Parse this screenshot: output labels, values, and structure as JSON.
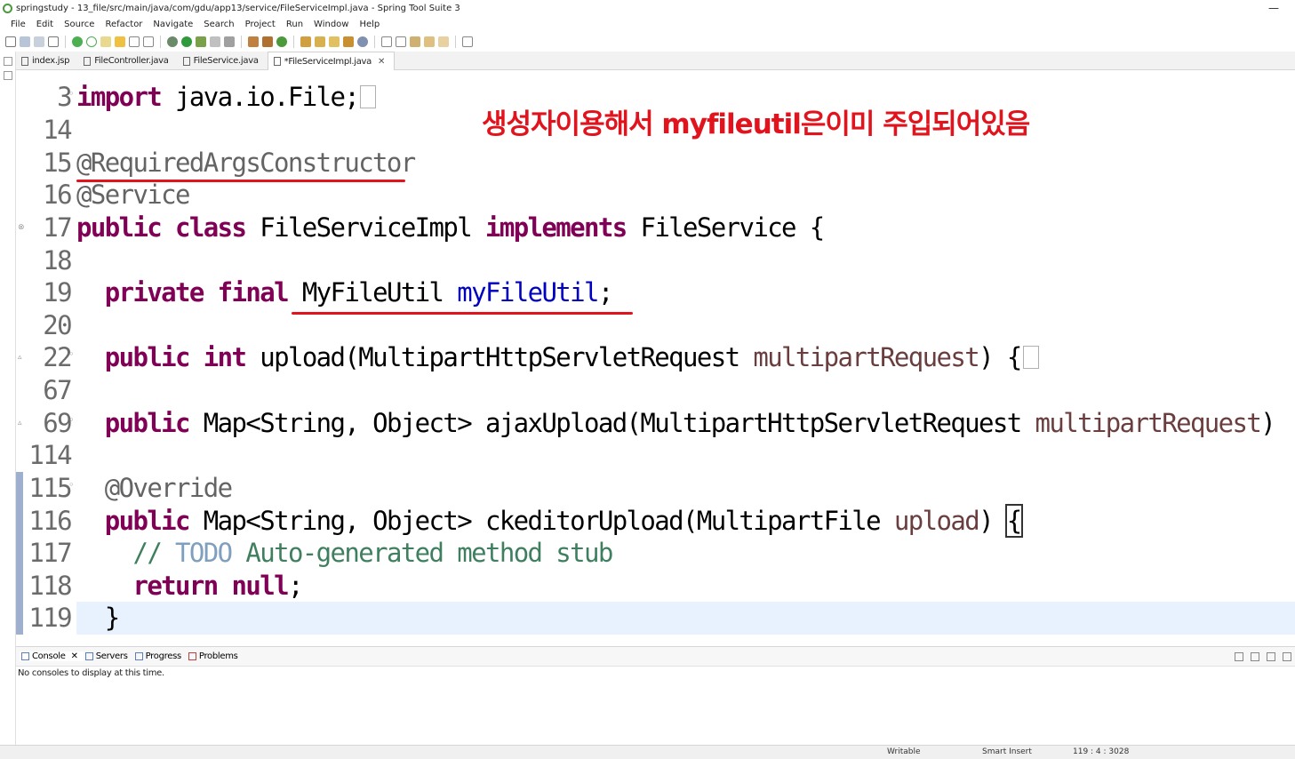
{
  "window": {
    "title": "springstudy - 13_file/src/main/java/com/gdu/app13/service/FileServiceImpl.java - Spring Tool Suite 3",
    "minimize_glyph": "—"
  },
  "menu": [
    "File",
    "Edit",
    "Source",
    "Refactor",
    "Navigate",
    "Search",
    "Project",
    "Run",
    "Window",
    "Help"
  ],
  "editor_tabs": [
    {
      "label": "index.jsp",
      "active": false
    },
    {
      "label": "FileController.java",
      "active": false
    },
    {
      "label": "FileService.java",
      "active": false
    },
    {
      "label": "*FileServiceImpl.java",
      "active": true
    }
  ],
  "code": {
    "lines": [
      {
        "num": "3",
        "text": "import java.io.File;"
      },
      {
        "num": "14",
        "text": ""
      },
      {
        "num": "15",
        "text": "@RequiredArgsConstructor"
      },
      {
        "num": "16",
        "text": "@Service"
      },
      {
        "num": "17",
        "text": "public class FileServiceImpl implements FileService {"
      },
      {
        "num": "18",
        "text": ""
      },
      {
        "num": "19",
        "text": "private final MyFileUtil myFileUtil;"
      },
      {
        "num": "20",
        "text": ""
      },
      {
        "num": "22",
        "text": "public int upload(MultipartHttpServletRequest multipartRequest) {"
      },
      {
        "num": "67",
        "text": ""
      },
      {
        "num": "69",
        "text": "public Map<String, Object> ajaxUpload(MultipartHttpServletRequest multipartRequest)"
      },
      {
        "num": "114",
        "text": ""
      },
      {
        "num": "115",
        "text": "@Override"
      },
      {
        "num": "116",
        "text": "public Map<String, Object> ckeditorUpload(MultipartFile upload) {"
      },
      {
        "num": "117",
        "text": "// TODO Auto-generated method stub"
      },
      {
        "num": "118",
        "text": "return null;"
      },
      {
        "num": "119",
        "text": "}"
      }
    ],
    "tokens": {
      "import_kw": "import",
      "import_rest": " java.io.File;",
      "ann_required": "@RequiredArgsConstructor",
      "ann_service": "@Service",
      "kw_public": "public",
      "kw_class": "class",
      "class_name": " FileServiceImpl ",
      "kw_implements": "implements",
      "impl_rest": " FileService {",
      "kw_private": "private",
      "kw_final": "final",
      "type_myfileutil": " MyFileUtil ",
      "field_myfileutil": "myFileUtil",
      "semicolon": ";",
      "kw_int": "int",
      "upload_sig": " upload(MultipartHttpServletRequest ",
      "param_multipart": "multipartRequest",
      "upload_close": ") {",
      "ajax_sig": " Map<String, Object> ajaxUpload(MultipartHttpServletRequest ",
      "ajax_close": ")",
      "ann_override": "@Override",
      "ck_sig": " Map<String, Object> ckeditorUpload(MultipartFile ",
      "param_upload": "upload",
      "ck_close_paren": ") ",
      "open_brace": "{",
      "comment_slashes": "// ",
      "comment_todo": "TODO",
      "comment_rest": " Auto-generated method stub",
      "kw_return": "return",
      "kw_null": "null",
      "close_brace": "}"
    }
  },
  "annotation": {
    "text": "생성자이용해서 myfileutil은이미 주입되어있음",
    "color": "#e1141e"
  },
  "bottom_panel": {
    "tabs": [
      "Console",
      "Servers",
      "Progress",
      "Problems"
    ],
    "message": "No consoles to display at this time."
  },
  "status": {
    "writable": "Writable",
    "insert_mode": "Smart Insert",
    "position": "119 : 4 : 3028"
  }
}
